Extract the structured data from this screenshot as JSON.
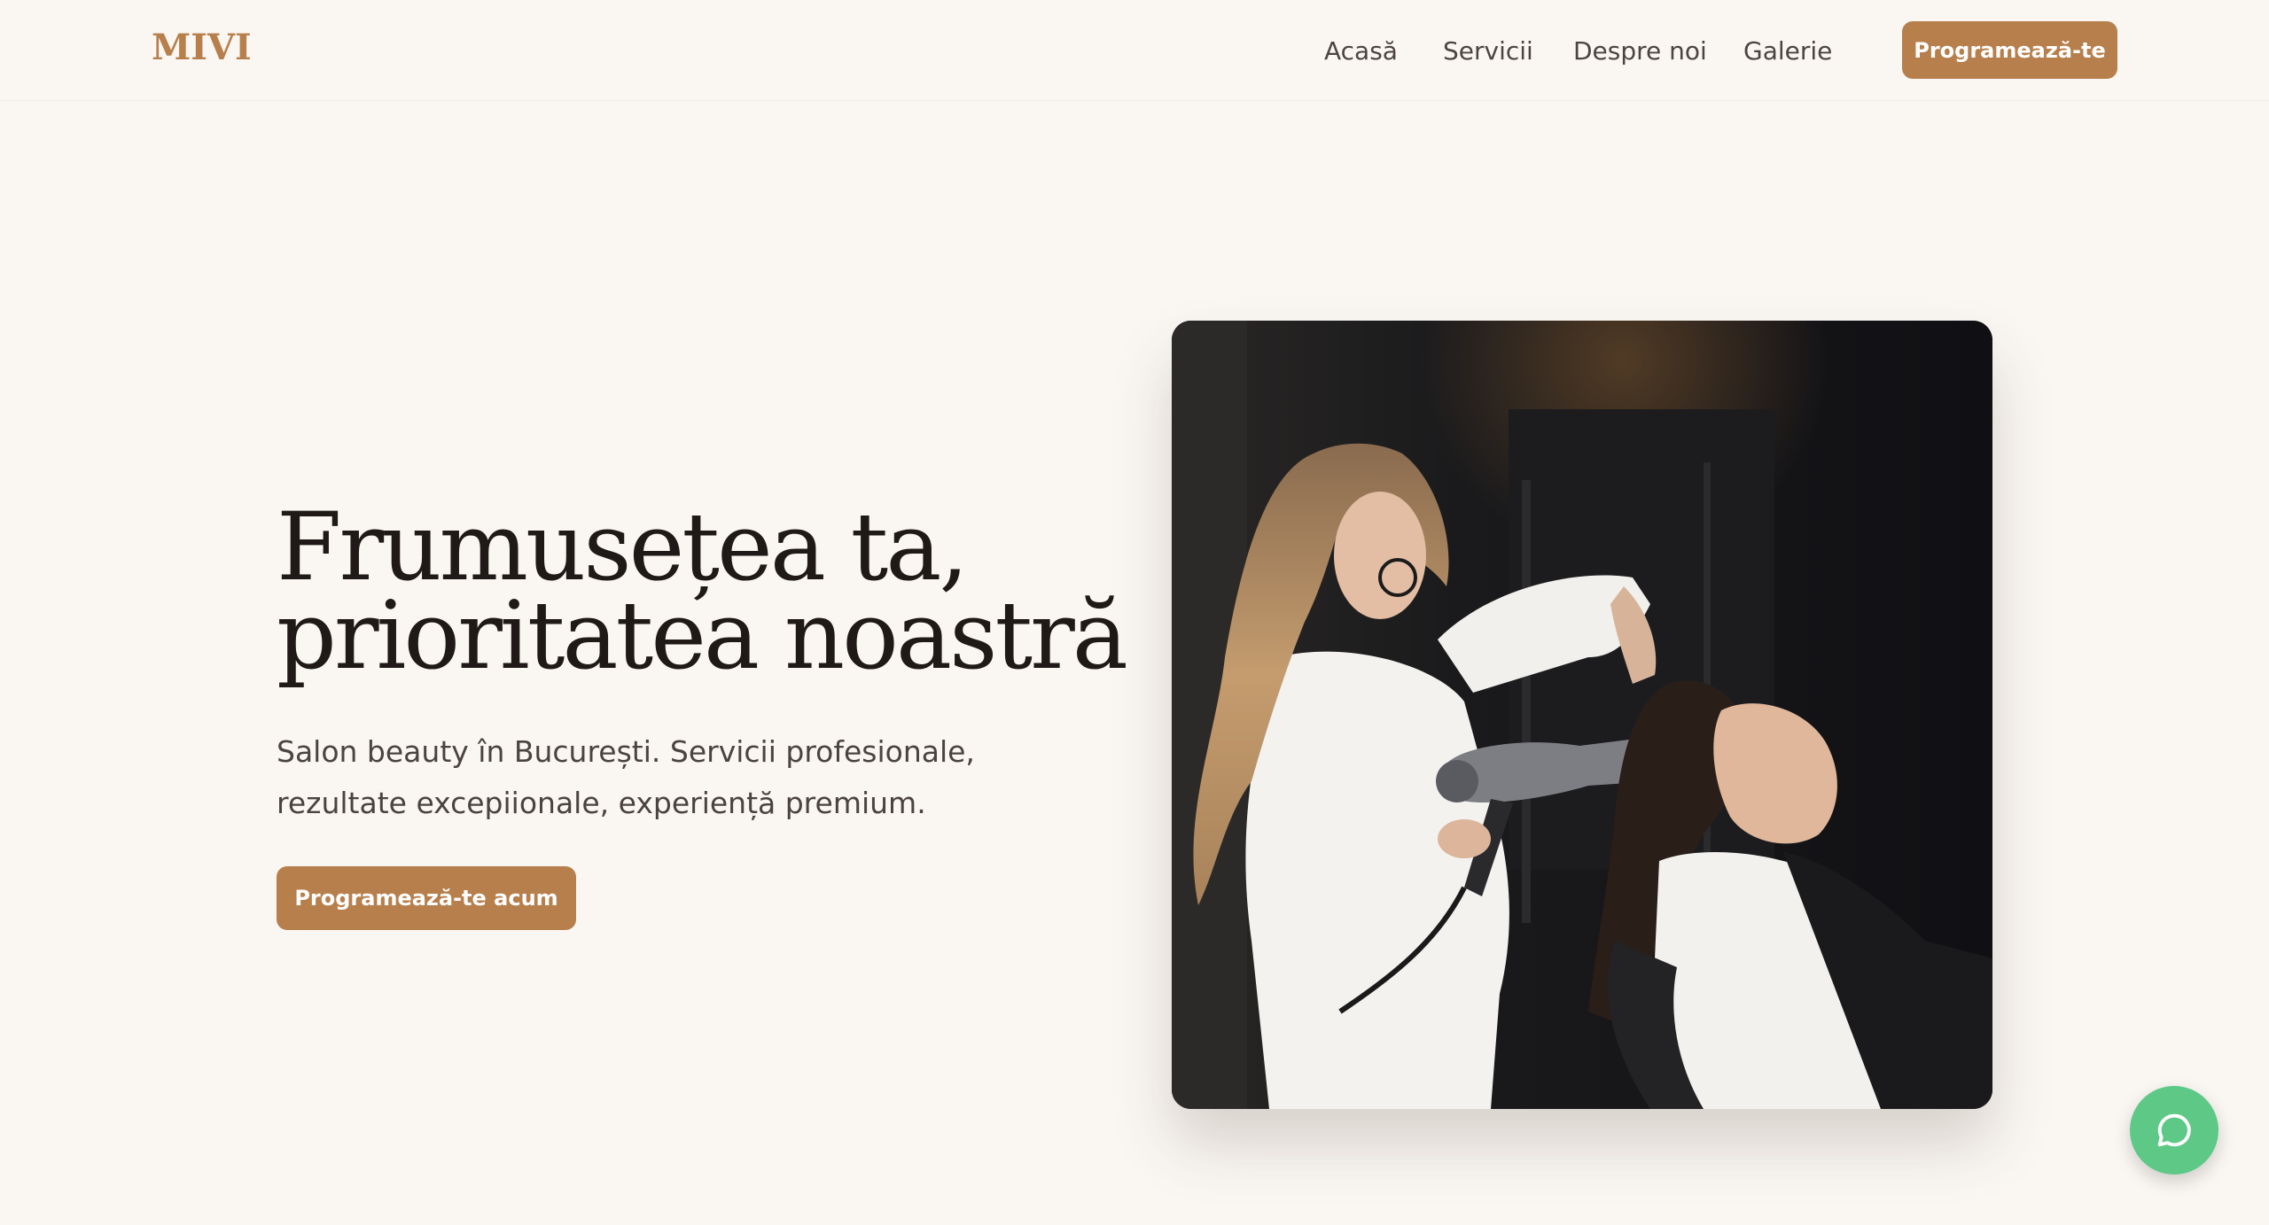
{
  "header": {
    "logo": "MIVI",
    "nav": [
      {
        "label": "Acasă"
      },
      {
        "label": "Servicii"
      },
      {
        "label": "Despre noi"
      },
      {
        "label": "Galerie"
      }
    ],
    "cta_label": "Programează-te"
  },
  "hero": {
    "title_line1": "Frumusețea ta,",
    "title_line2": "prioritatea noastră",
    "subtitle": "Salon beauty în București. Servicii profesionale, rezultate excepiionale, experiență premium.",
    "cta_label": "Programează-te acum"
  },
  "colors": {
    "accent": "#b77f4c",
    "background": "#faf7f3",
    "chat_green": "#5ec986"
  },
  "icons": {
    "chat": "chat-bubble-icon"
  }
}
